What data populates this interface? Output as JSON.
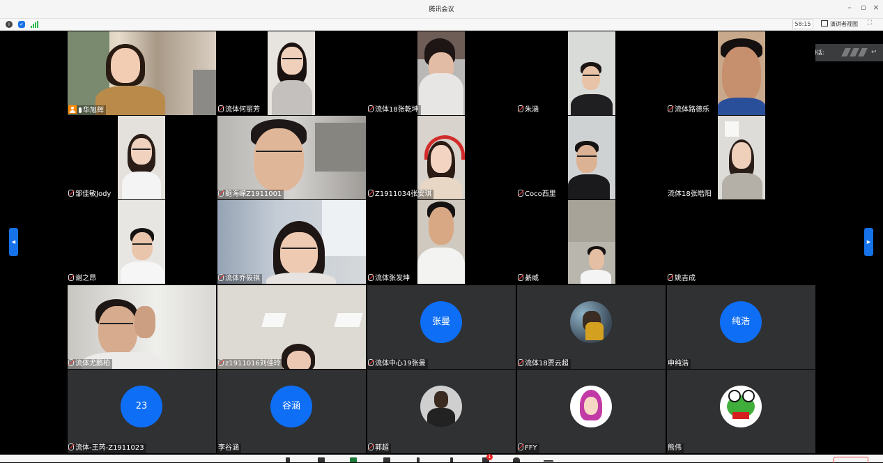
{
  "window": {
    "title": "腾讯会议",
    "minimize_icon": "minimize-icon",
    "restore_icon": "restore-icon",
    "close_icon": "close-icon"
  },
  "infobar": {
    "timer": "58:15",
    "speaker_view_label": "演讲者视图",
    "colors": {
      "signal": "#2db84d",
      "shield": "#1a73e8"
    }
  },
  "speaking": {
    "label": "正在讲话:"
  },
  "participants": [
    {
      "name": "华旭辉",
      "type": "video",
      "host": true,
      "mic": "on"
    },
    {
      "name": "流体何丽芳",
      "type": "video",
      "mic": "off"
    },
    {
      "name": "流体18张乾坤",
      "type": "video",
      "mic": "off"
    },
    {
      "name": "朱涵",
      "type": "video",
      "mic": "off"
    },
    {
      "name": "流体路德乐",
      "type": "video",
      "mic": "off"
    },
    {
      "name": "邹佳敏Jody",
      "type": "video",
      "mic": "off"
    },
    {
      "name": "鲍海嵘Z1911001",
      "type": "video",
      "mic": "off"
    },
    {
      "name": "Z1911034张安琪",
      "type": "video",
      "mic": "off"
    },
    {
      "name": "Coco西里",
      "type": "video",
      "mic": "off"
    },
    {
      "name": "流体18张皓阳",
      "type": "video",
      "mic": "none"
    },
    {
      "name": "谢之昂",
      "type": "video",
      "mic": "off"
    },
    {
      "name": "流体乔筱祺",
      "type": "video",
      "mic": "off"
    },
    {
      "name": "流体张发坤",
      "type": "video",
      "mic": "off"
    },
    {
      "name": "綦威",
      "type": "video",
      "mic": "off"
    },
    {
      "name": "姚吉成",
      "type": "video",
      "mic": "off"
    },
    {
      "name": "流体尤鹏柏",
      "type": "video",
      "mic": "off"
    },
    {
      "name": "z1911016刘佳玲",
      "type": "video",
      "mic": "off"
    },
    {
      "name": "流体中心19张曼",
      "type": "avatar-text",
      "avatar_text": "张曼",
      "mic": "off"
    },
    {
      "name": "流体18贾云超",
      "type": "avatar-image",
      "mic": "off"
    },
    {
      "name": "申纯浩",
      "type": "avatar-text",
      "avatar_text": "纯浩",
      "mic": "none"
    },
    {
      "name": "流体-王芮-Z1911023",
      "type": "avatar-text",
      "avatar_text": "23",
      "mic": "off"
    },
    {
      "name": "李谷涵",
      "type": "avatar-text",
      "avatar_text": "谷涵",
      "mic": "none"
    },
    {
      "name": "郭超",
      "type": "avatar-image",
      "mic": "off"
    },
    {
      "name": "FFY",
      "type": "avatar-image",
      "mic": "off"
    },
    {
      "name": "熊伟",
      "type": "avatar-image",
      "mic": "none"
    }
  ],
  "toolbar": {
    "notification_count": "1"
  },
  "colors": {
    "accent": "#0e6ef5",
    "tile_dark": "#303133",
    "host_badge": "#ff8a00",
    "end_button": "#e44"
  }
}
